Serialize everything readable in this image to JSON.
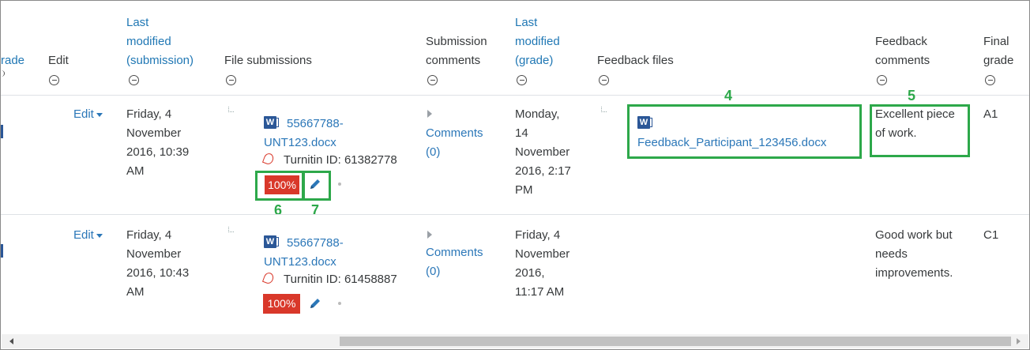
{
  "headers": {
    "grade_partial": "rade",
    "edit": "Edit",
    "last_modified_submission": [
      "Last",
      "modified",
      "(submission)"
    ],
    "file_submissions": "File submissions",
    "submission_comments": [
      "Submission",
      "comments"
    ],
    "last_modified_grade": [
      "Last",
      "modified",
      "(grade)"
    ],
    "feedback_files": "Feedback files",
    "feedback_comments": [
      "Feedback",
      "comments"
    ],
    "final_grade": [
      "Final",
      "grade"
    ]
  },
  "rows": [
    {
      "edit_label": "Edit",
      "last_modified_submission": [
        "Friday, 4",
        "November",
        "2016, 10:39",
        "AM"
      ],
      "file_name": [
        "55667788-",
        "UNT123.docx"
      ],
      "turnitin": "Turnitin ID: 61382778",
      "similarity": "100%",
      "comments_label": "Comments",
      "comments_count": "(0)",
      "last_modified_grade": [
        "Monday,",
        "14",
        "November",
        "2016, 2:17",
        "PM"
      ],
      "feedback_file": "Feedback_Participant_123456.docx",
      "feedback_comment": [
        "Excellent piece",
        "of work."
      ],
      "final_grade": "A1"
    },
    {
      "edit_label": "Edit",
      "last_modified_submission": [
        "Friday, 4",
        "November",
        "2016, 10:43",
        "AM"
      ],
      "file_name": [
        "55667788-",
        "UNT123.docx"
      ],
      "turnitin": "Turnitin ID: 61458887",
      "similarity": "100%",
      "comments_label": "Comments",
      "comments_count": "(0)",
      "last_modified_grade": [
        "Friday, 4",
        "November",
        "2016,",
        "11:17 AM"
      ],
      "feedback_file": "",
      "feedback_comment": [
        "Good work but",
        "needs",
        "improvements."
      ],
      "final_grade": "C1"
    }
  ],
  "annotations": [
    "4",
    "5",
    "6",
    "7"
  ],
  "icons": {
    "collapse": "minus-circle-icon",
    "word": "word-document-icon",
    "turnitin": "turnitin-icon",
    "edit_pencil": "pencil-icon",
    "expand": "triangle-right-icon"
  },
  "colors": {
    "link": "#2b77b8",
    "highlight": "#2da84a",
    "similarity_badge": "#d9382a"
  }
}
